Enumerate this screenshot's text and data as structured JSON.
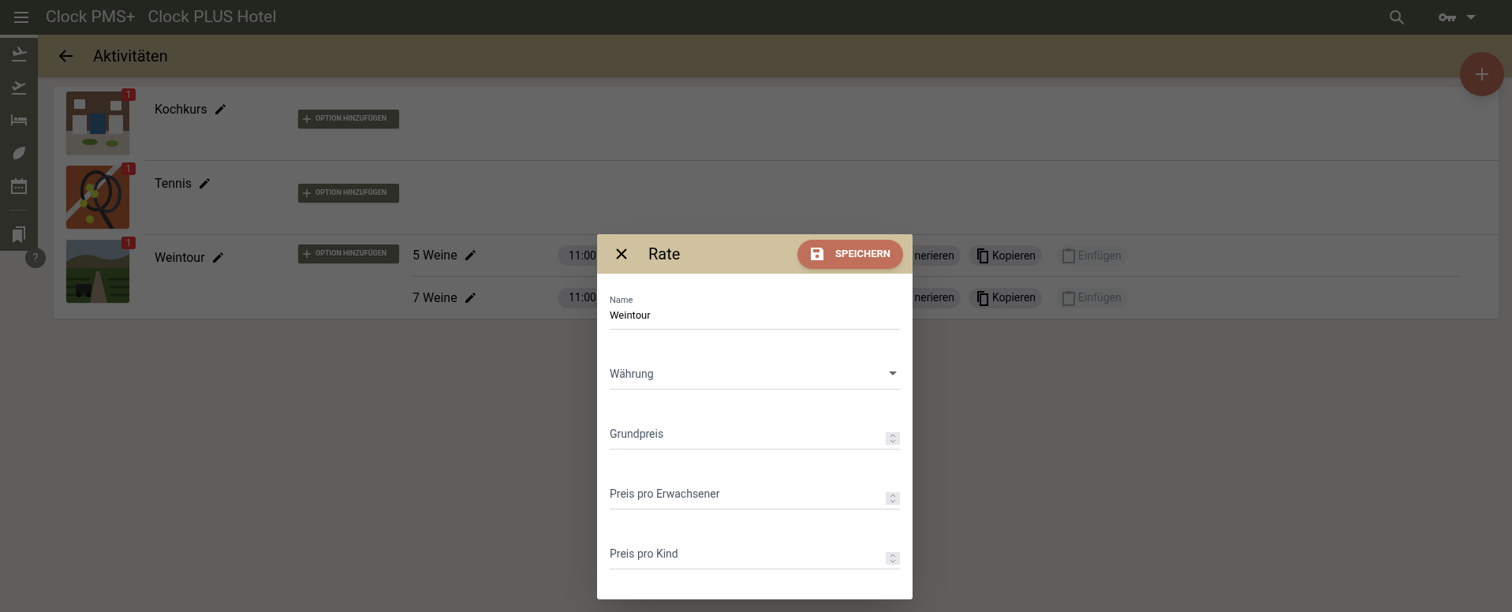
{
  "app_bar": {
    "title": "Clock PMS+",
    "hotel": "Clock PLUS Hotel"
  },
  "page": {
    "title": "Aktivitäten"
  },
  "help_label": "?",
  "activities": [
    {
      "name": "Kochkurs",
      "badge": "1",
      "add_option_label": "OPTION HINZUFÜGEN"
    },
    {
      "name": "Tennis",
      "badge": "1",
      "add_option_label": "OPTION HINZUFÜGEN"
    },
    {
      "name": "Weintour",
      "badge": "1",
      "add_option_label": "OPTION HINZUFÜGEN",
      "options": [
        {
          "name": "5 Weine",
          "time": "11:00",
          "generate_label": "nerieren",
          "copy_label": "Kopieren",
          "paste_label": "Einfügen",
          "paste_disabled": true
        },
        {
          "name": "7 Weine",
          "time": "11:00",
          "generate_label": "nerieren",
          "copy_label": "Kopieren",
          "paste_label": "Einfügen",
          "paste_disabled": true
        }
      ]
    }
  ],
  "dialog": {
    "title": "Rate",
    "save_label": "SPEICHERN",
    "fields": [
      {
        "kind": "text",
        "label": "Name",
        "value": "Weintour"
      },
      {
        "kind": "select",
        "label": "Währung"
      },
      {
        "kind": "number",
        "label": "Grundpreis"
      },
      {
        "kind": "number",
        "label": "Preis pro Erwachsener"
      },
      {
        "kind": "number",
        "label": "Preis pro Kind"
      }
    ]
  }
}
